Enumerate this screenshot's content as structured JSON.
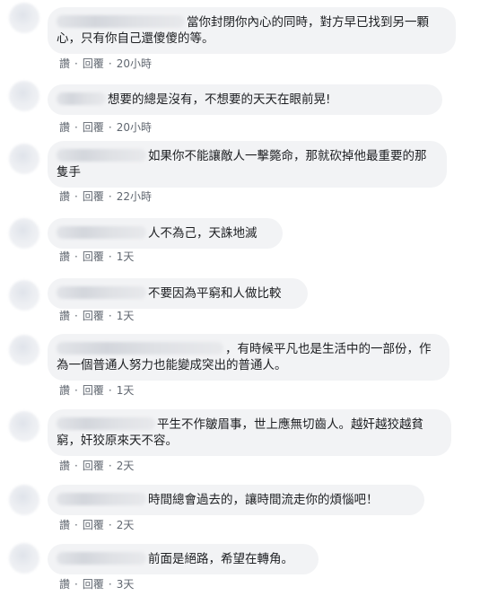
{
  "comments": [
    {
      "text": "當你封閉你內心的同時，對方早已找到另一顆心，只有你自己還傻傻的等。",
      "time": "20小時"
    },
    {
      "text": "想要的總是沒有，不想要的天天在眼前晃!",
      "time": "20小時"
    },
    {
      "text": "如果你不能讓敵人一擊斃命，那就砍掉他最重要的那隻手",
      "time": "22小時"
    },
    {
      "text": "人不為己，天誅地滅",
      "time": "1天"
    },
    {
      "text": "不要因為平窮和人做比較",
      "time": "1天"
    },
    {
      "text": "，有時候平凡也是生活中的一部份，作為一個普通人努力也能變成突出的普通人。",
      "time": "1天"
    },
    {
      "text": "平生不作皺眉事，世上應無切齒人。越奸越狡越貧窮，奸狡原來天不容。",
      "time": "2天"
    },
    {
      "text": "時間總會過去的，讓時間流走你的煩惱吧！",
      "time": "2天"
    },
    {
      "text": "前面是絕路，希望在轉角。",
      "time": "3天"
    }
  ],
  "actions": {
    "like": "讚",
    "reply": "回覆",
    "separator": "·"
  }
}
